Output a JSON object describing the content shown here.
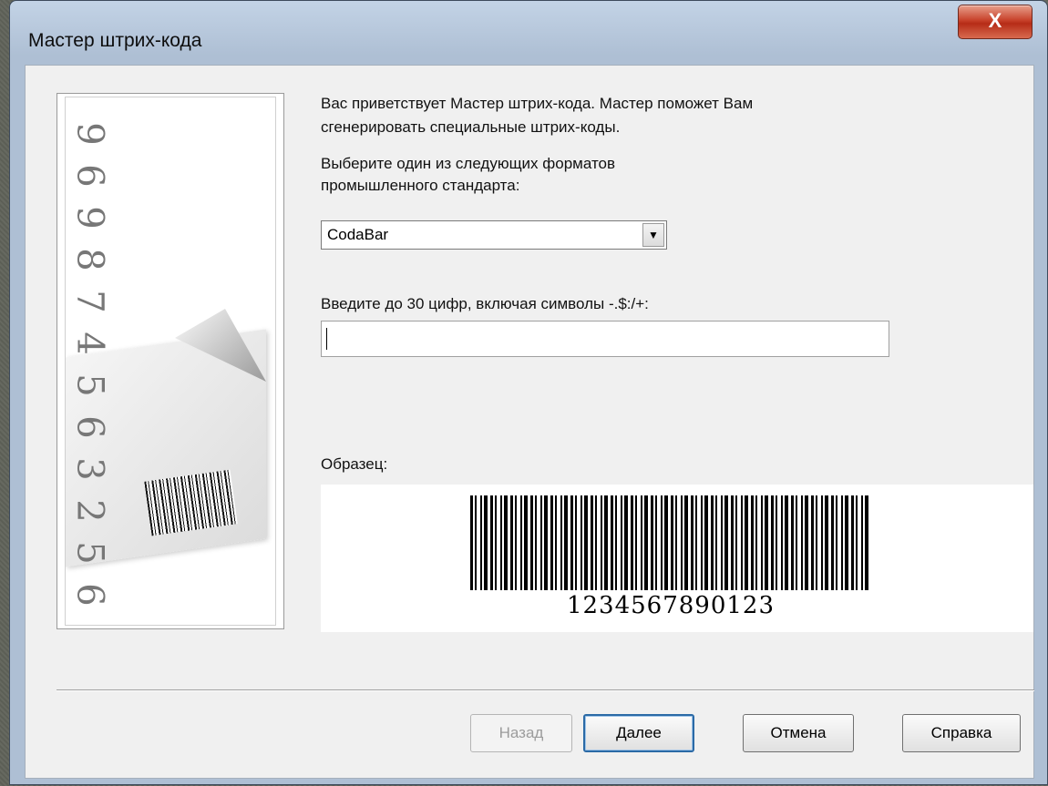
{
  "window": {
    "title": "Мастер штрих-кода",
    "close_label": "X"
  },
  "side_panel": {
    "digits": [
      "9",
      "6",
      "9",
      "8",
      "7",
      "4",
      "5",
      "6",
      "3",
      "2",
      "5",
      "6"
    ]
  },
  "intro": {
    "line1": "Вас приветствует Мастер штрих-кода.  Мастер поможет Вам",
    "line2": "сгенерировать специальные штрих-коды.",
    "line3": "Выберите один из следующих форматов",
    "line4": "промышленного стандарта:"
  },
  "format_select": {
    "value": "CodaBar",
    "options": [
      "CodaBar"
    ]
  },
  "digits_prompt": "Введите до 30 цифр, включая символы -.$:/+:",
  "digits_input": {
    "value": "",
    "placeholder": ""
  },
  "sample": {
    "label": "Образец:",
    "barcode_number": "1234567890123"
  },
  "buttons": {
    "back": "Назад",
    "next": "Далее",
    "cancel": "Отмена",
    "help": "Справка"
  }
}
